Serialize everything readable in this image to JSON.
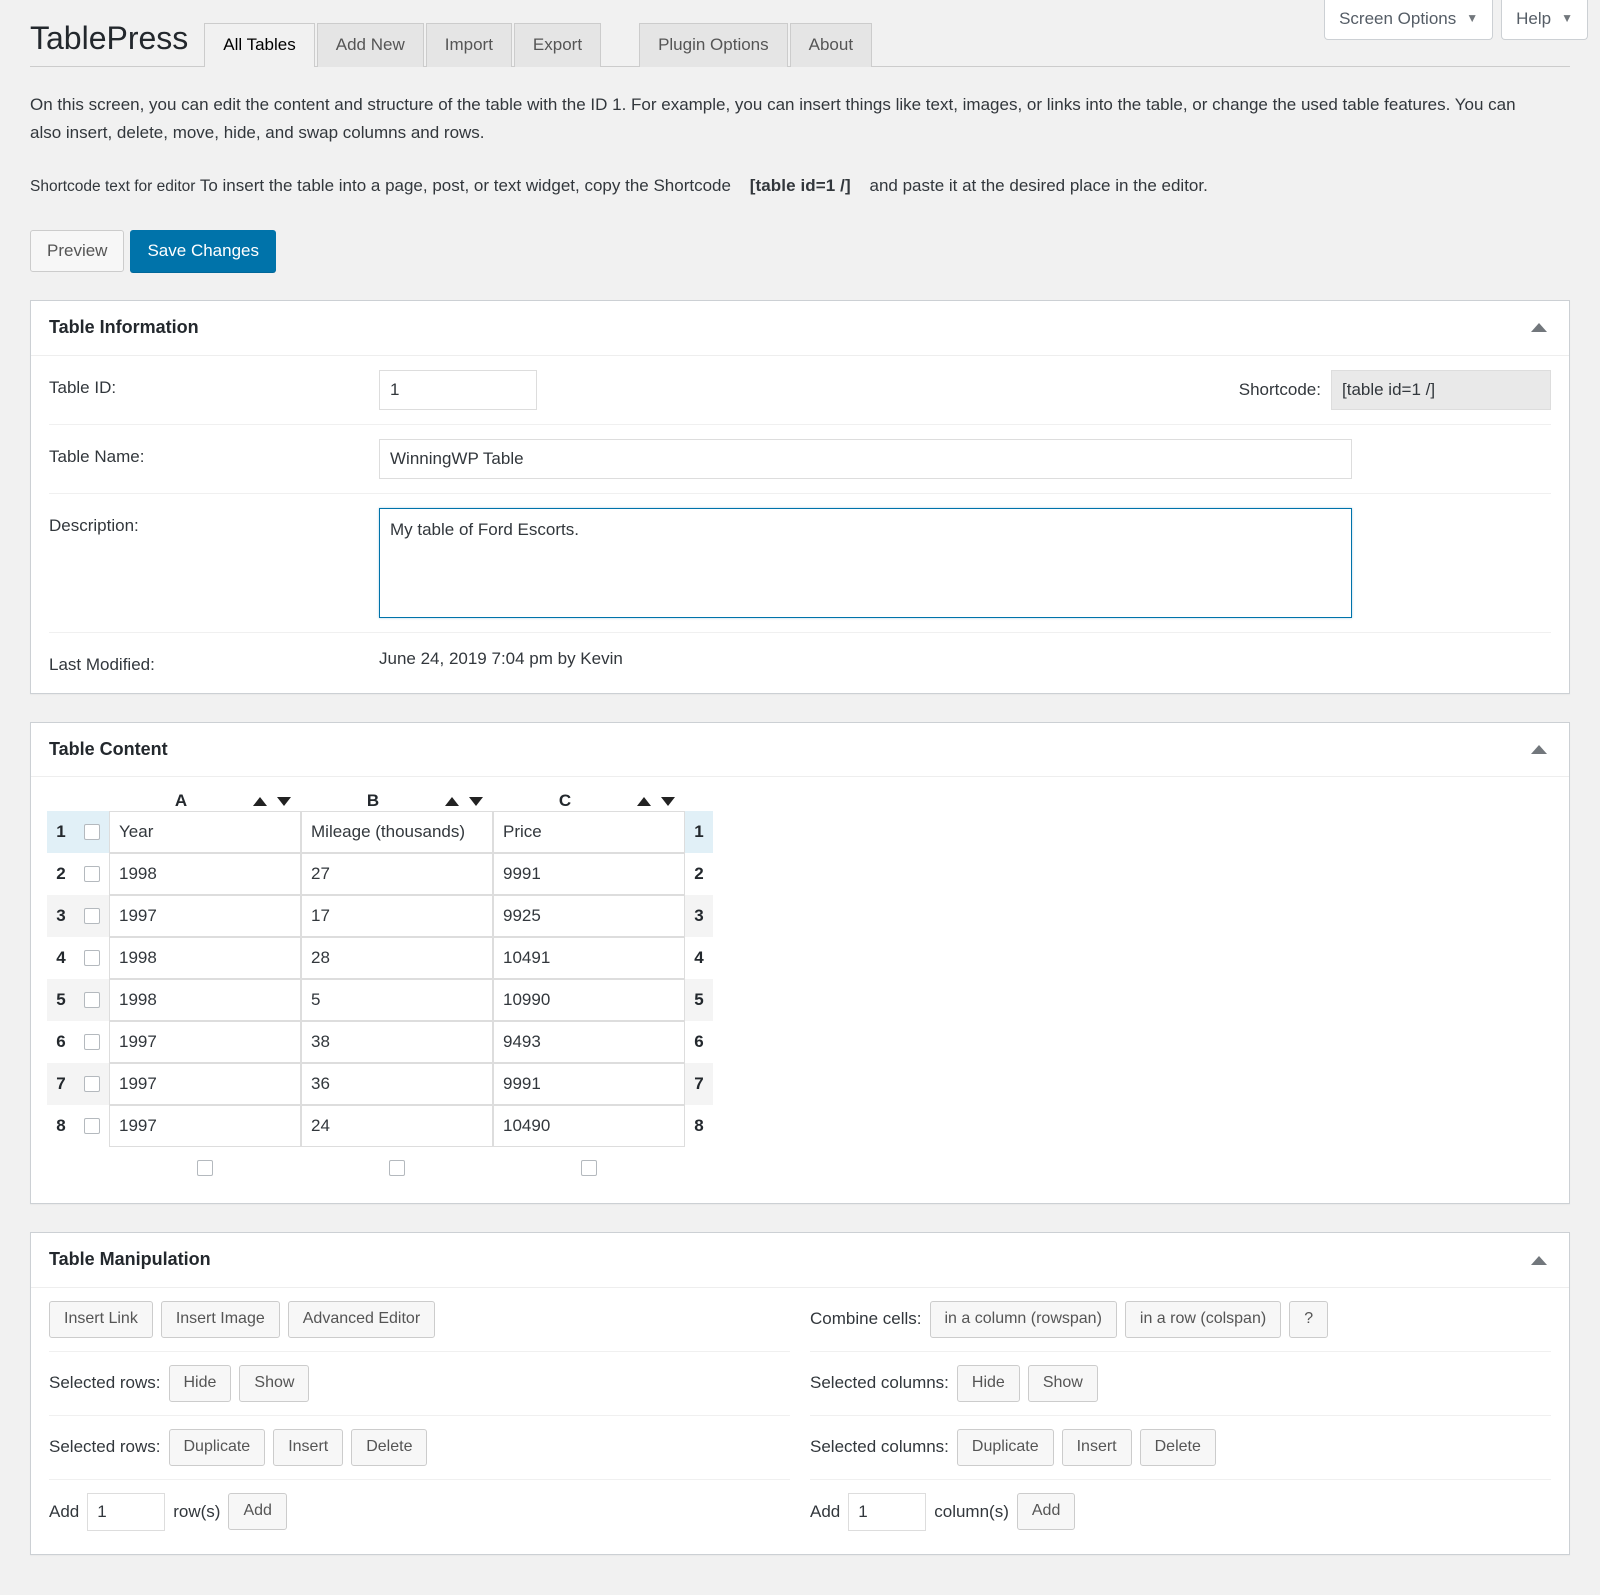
{
  "meta_bar": {
    "screen_options": "Screen Options",
    "help": "Help",
    "caret": "▼"
  },
  "header": {
    "app_title": "TablePress",
    "tabs": [
      {
        "label": "All Tables",
        "active": true
      },
      {
        "label": "Add New",
        "active": false
      },
      {
        "label": "Import",
        "active": false
      },
      {
        "label": "Export",
        "active": false
      },
      {
        "label": "Plugin Options",
        "active": false
      },
      {
        "label": "About",
        "active": false
      }
    ]
  },
  "intro": {
    "paragraph": "On this screen, you can edit the content and structure of the table with the ID 1. For example, you can insert things like text, images, or links into the table, or change the used table features. You can also insert, delete, move, hide, and swap columns and rows.",
    "shortcode_label": "Shortcode text for editor",
    "shortcode_text_before": "To insert the table into a page, post, or text widget, copy the Shortcode",
    "shortcode_code": "[table id=1 /]",
    "shortcode_text_after": "and paste it at the desired place in the editor."
  },
  "actions": {
    "preview": "Preview",
    "save_changes": "Save Changes"
  },
  "table_information": {
    "panel_title": "Table Information",
    "table_id_label": "Table ID:",
    "table_id_value": "1",
    "shortcode_label": "Shortcode:",
    "shortcode_value": "[table id=1 /]",
    "table_name_label": "Table Name:",
    "table_name_value": "WinningWP Table",
    "description_label": "Description:",
    "description_value": "My table of Ford Escorts.",
    "last_modified_label": "Last Modified:",
    "last_modified_value": "June 24, 2019 7:04 pm by Kevin"
  },
  "table_content": {
    "panel_title": "Table Content",
    "columns": [
      "A",
      "B",
      "C"
    ],
    "sort_up": "sort-ascending-icon",
    "sort_down": "sort-descending-icon",
    "rows": [
      {
        "number": "1",
        "cells": [
          "Year",
          "Mileage (thousands)",
          "Price"
        ]
      },
      {
        "number": "2",
        "cells": [
          "1998",
          "27",
          "9991"
        ]
      },
      {
        "number": "3",
        "cells": [
          "1997",
          "17",
          "9925"
        ]
      },
      {
        "number": "4",
        "cells": [
          "1998",
          "28",
          "10491"
        ]
      },
      {
        "number": "5",
        "cells": [
          "1998",
          "5",
          "10990"
        ]
      },
      {
        "number": "6",
        "cells": [
          "1997",
          "38",
          "9493"
        ]
      },
      {
        "number": "7",
        "cells": [
          "1997",
          "36",
          "9991"
        ]
      },
      {
        "number": "8",
        "cells": [
          "1997",
          "24",
          "10490"
        ]
      }
    ]
  },
  "table_manipulation": {
    "panel_title": "Table Manipulation",
    "insert_link": "Insert Link",
    "insert_image": "Insert Image",
    "advanced_editor": "Advanced Editor",
    "combine_cells_label": "Combine cells:",
    "combine_rowspan": "in a column (rowspan)",
    "combine_colspan": "in a row (colspan)",
    "combine_help": "?",
    "selected_rows_label": "Selected rows:",
    "selected_columns_label": "Selected columns:",
    "hide": "Hide",
    "show": "Show",
    "duplicate": "Duplicate",
    "insert": "Insert",
    "delete": "Delete",
    "add_label": "Add",
    "add_rows_value": "1",
    "rows_unit": "row(s)",
    "add_rows_button": "Add",
    "add_columns_value": "1",
    "columns_unit": "column(s)",
    "add_columns_button": "Add"
  },
  "colors": {
    "accent": "#0073aa",
    "page_bg": "#f1f1f1",
    "panel_border": "#ccd0d4",
    "header_row_bg": "#e1f0f7"
  }
}
